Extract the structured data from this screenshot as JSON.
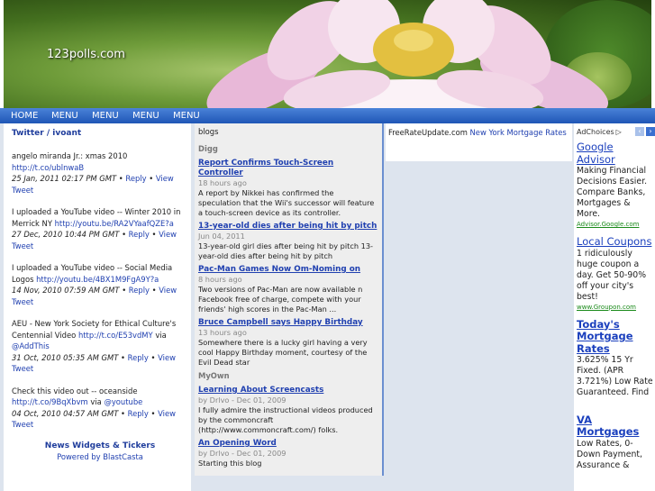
{
  "site": {
    "title": "123polls.com"
  },
  "nav": {
    "items": [
      "HOME",
      "MENU",
      "MENU",
      "MENU",
      "MENU"
    ]
  },
  "twitter": {
    "title": "Twitter / ivoant",
    "tweets": [
      {
        "prefix": "angelo miranda Jr.: xmas 2010 ",
        "link": "http://t.co/ublnwaB",
        "mid": "",
        "link2": "",
        "time": "25 Jan, 2011 02:17 PM GMT",
        "reply": "Reply",
        "view": "View Tweet"
      },
      {
        "prefix": "I uploaded a YouTube video -- Winter 2010 in Merrick NY ",
        "link": "http://youtu.be/RA2VYaafQZE?a",
        "mid": "",
        "link2": "",
        "time": "27 Dec, 2010 10:44 PM GMT",
        "reply": "Reply",
        "view": "View Tweet"
      },
      {
        "prefix": "I uploaded a YouTube video -- Social Media Logos ",
        "link": "http://youtu.be/4BX1M9FgA9Y?a",
        "mid": "",
        "link2": "",
        "time": "14 Nov, 2010 07:59 AM GMT",
        "reply": "Reply",
        "view": "View Tweet"
      },
      {
        "prefix": "AEU - New York Society for Ethical Culture's Centennial Video ",
        "link": "http://t.co/E53vdMY",
        "mid": " via ",
        "link2": "@AddThis",
        "time": "31 Oct, 2010 05:35 AM GMT",
        "reply": "Reply",
        "view": "View Tweet"
      },
      {
        "prefix": "Check this video out -- oceanside ",
        "link": "http://t.co/9BqXbvm",
        "mid": " via ",
        "link2": "@youtube",
        "time": "04 Oct, 2010 04:57 AM GMT",
        "reply": "Reply",
        "view": "View Tweet"
      }
    ],
    "footer_title": "News Widgets & Tickers",
    "footer_sub": "Powered by BlastCasta"
  },
  "blogs": {
    "title": "blogs",
    "sections": [
      {
        "name": "Digg",
        "posts": [
          {
            "title": "Report Confirms Touch-Screen Controller",
            "time": "18 hours ago",
            "body": "A report by Nikkei has confirmed the speculation that the Wii's successor will feature a touch-screen device as its controller."
          },
          {
            "title": "13-year-old dies after being hit by pitch",
            "time": "Jun 04, 2011",
            "body": "13-year-old girl dies after being hit by pitch 13-year-old dies after being hit by pitch"
          },
          {
            "title": "Pac-Man Games Now Om-Noming on",
            "time": "8 hours ago",
            "body": "Two versions of Pac-Man are now available n Facebook free of charge, compete with your friends' high scores in the Pac-Man ..."
          },
          {
            "title": "Bruce Campbell says Happy Birthday",
            "time": "13 hours ago",
            "body": "Somewhere there is a lucky girl having a very cool Happy Birthday moment, courtesy of the Evil Dead star"
          }
        ]
      },
      {
        "name": "MyOwn",
        "posts": [
          {
            "title": "Learning About Screencasts",
            "time": "by Drlvo - Dec 01, 2009",
            "body": "I fully admire the instructional videos produced by the commoncraft (http://www.commoncraft.com/) folks."
          },
          {
            "title": "An Opening Word",
            "time": "by Drlvo - Dec 01, 2009",
            "body": "Starting this blog"
          }
        ]
      }
    ]
  },
  "rate": {
    "site": "FreeRateUpdate.com",
    "link": "New York Mortgage Rates"
  },
  "ads": {
    "adchoices": "AdChoices",
    "items": [
      {
        "title": "Google Advisor",
        "body": "Making Financial Decisions Easier. Compare Banks, Mortgages & More.",
        "url": "Advisor.Google.com",
        "bold": false
      },
      {
        "title": "Local Coupons",
        "body": "1 ridiculously huge coupon a day. Get 50-90% off your city's best!",
        "url": "www.Groupon.com",
        "bold": false
      },
      {
        "title": "Today's Mortgage Rates",
        "body": "3.625% 15 Yr Fixed. (APR 3.721%) Low Rate Guaranteed. Find",
        "url": "",
        "bold": true
      },
      {
        "title": "VA Mortgages",
        "body": "Low Rates, 0-Down Payment, Assurance &",
        "url": "",
        "bold": false
      }
    ]
  },
  "colors": {
    "nav": "#1f56b6",
    "link": "#2040b0",
    "ad_url": "#1a8a1a"
  }
}
